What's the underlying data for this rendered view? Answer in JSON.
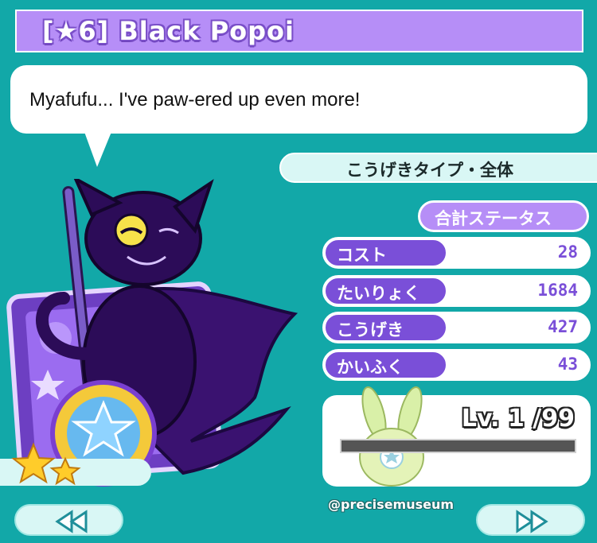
{
  "title": "[★6] Black Popoi",
  "speech": "Myafufu... I've paw-ered up even more!",
  "type_label": "こうげきタイプ・全体",
  "total_status_label": "合計ステータス",
  "stats": [
    {
      "label": "コスト",
      "value": "28"
    },
    {
      "label": "たいりょく",
      "value": "1684"
    },
    {
      "label": "こうげき",
      "value": "427"
    },
    {
      "label": "かいふく",
      "value": "43"
    }
  ],
  "level": {
    "text": "Lv. 1 /99",
    "exp_fraction": 0
  },
  "rarity_stars": 6,
  "watermark": "@precisemuseum",
  "colors": {
    "background": "#12a8a8",
    "accent_purple": "#b68ef7",
    "label_purple": "#7a4fd8"
  }
}
